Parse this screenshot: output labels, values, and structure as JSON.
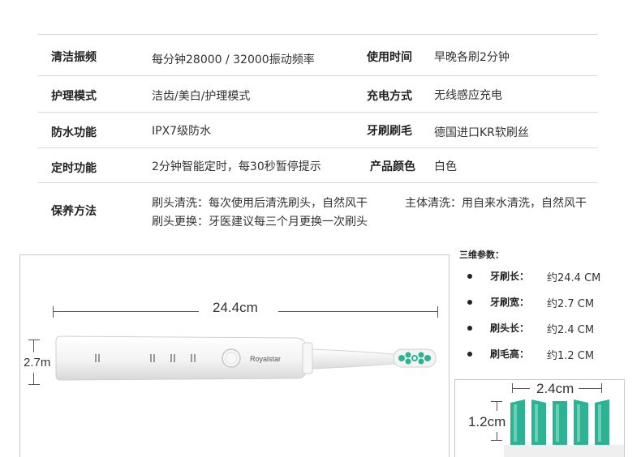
{
  "specs": {
    "rows": [
      {
        "label": "清洁振频",
        "value": "每分钟28000 / 32000振动频率",
        "label2": "使用时间",
        "value2": "早晚各刷2分钟"
      },
      {
        "label": "护理模式",
        "value": "洁齿/美白/护理模式",
        "label2": "充电方式",
        "value2": "无线感应充电"
      },
      {
        "label": "防水功能",
        "value": "IPX7级防水",
        "label2": "牙刷刷毛",
        "value2": "德国进口KR软刷丝"
      },
      {
        "label": "定时功能",
        "value": "2分钟智能定时，每30秒暂停提示",
        "label2": "产品颜色",
        "value2": "白色"
      }
    ],
    "care": {
      "label": "保养方法",
      "head_clean": "刷头清洗：每次使用后清洗刷头，自然风干",
      "body_clean": "主体清洗：用自来水清洗，自然风干",
      "head_replace": "刷头更换：牙医建议每三个月更换一次刷头"
    }
  },
  "product": {
    "length_label": "24.4cm",
    "width_label": "2.7m",
    "brand": "Royalstar",
    "colors": {
      "bristle_green": "#2bb394",
      "body_white": "#f4f4f4",
      "line": "#555555"
    }
  },
  "params": {
    "title": "三维参数：",
    "items": [
      {
        "name": "牙刷长：",
        "value": "约24.4  CM"
      },
      {
        "name": "牙刷宽：",
        "value": "约2.7  CM"
      },
      {
        "name": "刷头长：",
        "value": "约2.4  CM"
      },
      {
        "name": "刷毛高：",
        "value": "约1.2  CM"
      }
    ]
  },
  "head_detail": {
    "width_label": "2.4cm",
    "height_label": "1.2cm"
  }
}
